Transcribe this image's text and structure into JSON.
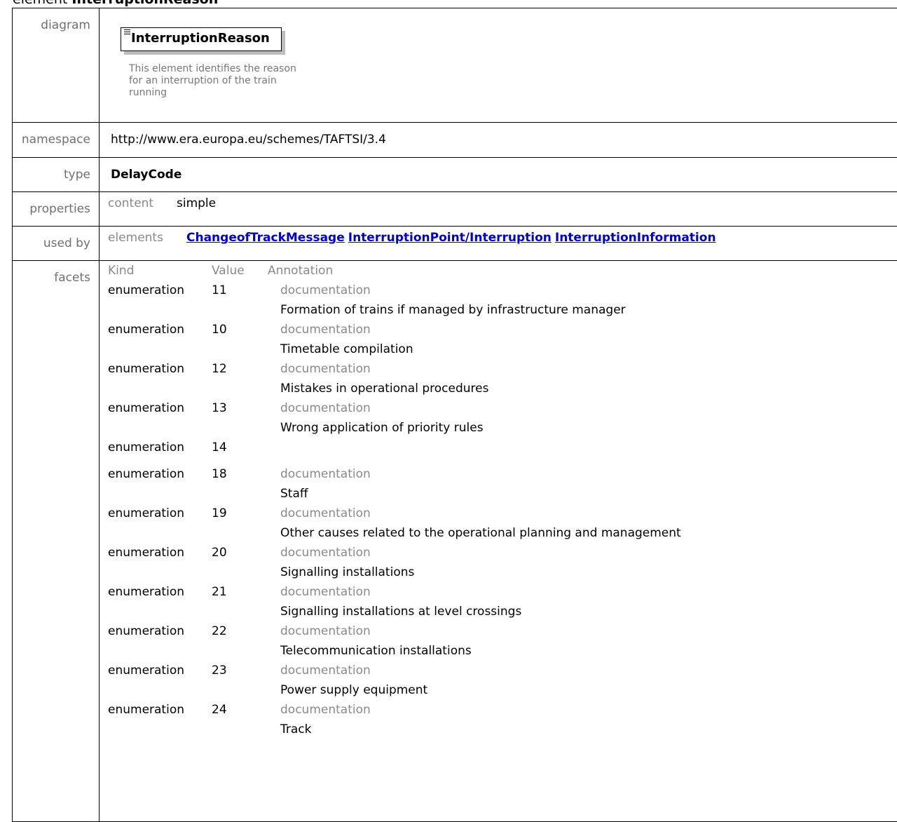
{
  "heading": {
    "prefix": "element",
    "name": "InterruptionReason"
  },
  "labels": {
    "diagram": "diagram",
    "namespace": "namespace",
    "type": "type",
    "properties": "properties",
    "used_by": "used by",
    "facets": "facets"
  },
  "diagram": {
    "element_name": "InterruptionReason",
    "documentation": "This element identifies the reason for an interruption of the train running"
  },
  "namespace": "http://www.era.europa.eu/schemes/TAFTSI/3.4",
  "type": "DelayCode",
  "properties": {
    "key": "content",
    "value": "simple"
  },
  "used_by": {
    "kind": "elements",
    "links": [
      "ChangeofTrackMessage",
      "InterruptionPoint/Interruption",
      "InterruptionInformation"
    ]
  },
  "facets": {
    "headers": {
      "kind": "Kind",
      "value": "Value",
      "annotation": "Annotation"
    },
    "doc_label": "documentation",
    "rows": [
      {
        "kind": "enumeration",
        "value": "11",
        "doc": "Formation of trains if managed by infrastructure manager"
      },
      {
        "kind": "enumeration",
        "value": "10",
        "doc": "Timetable compilation"
      },
      {
        "kind": "enumeration",
        "value": "12",
        "doc": "Mistakes in operational procedures"
      },
      {
        "kind": "enumeration",
        "value": "13",
        "doc": "Wrong application of priority rules"
      },
      {
        "kind": "enumeration",
        "value": "14",
        "doc": ""
      },
      {
        "kind": "enumeration",
        "value": "18",
        "doc": "Staff"
      },
      {
        "kind": "enumeration",
        "value": "19",
        "doc": "Other causes related to the operational planning and management"
      },
      {
        "kind": "enumeration",
        "value": "20",
        "doc": "Signalling installations"
      },
      {
        "kind": "enumeration",
        "value": "21",
        "doc": "Signalling installations at level crossings"
      },
      {
        "kind": "enumeration",
        "value": "22",
        "doc": "Telecommunication installations"
      },
      {
        "kind": "enumeration",
        "value": "23",
        "doc": "Power supply equipment"
      },
      {
        "kind": "enumeration",
        "value": "24",
        "doc": "Track"
      }
    ]
  }
}
